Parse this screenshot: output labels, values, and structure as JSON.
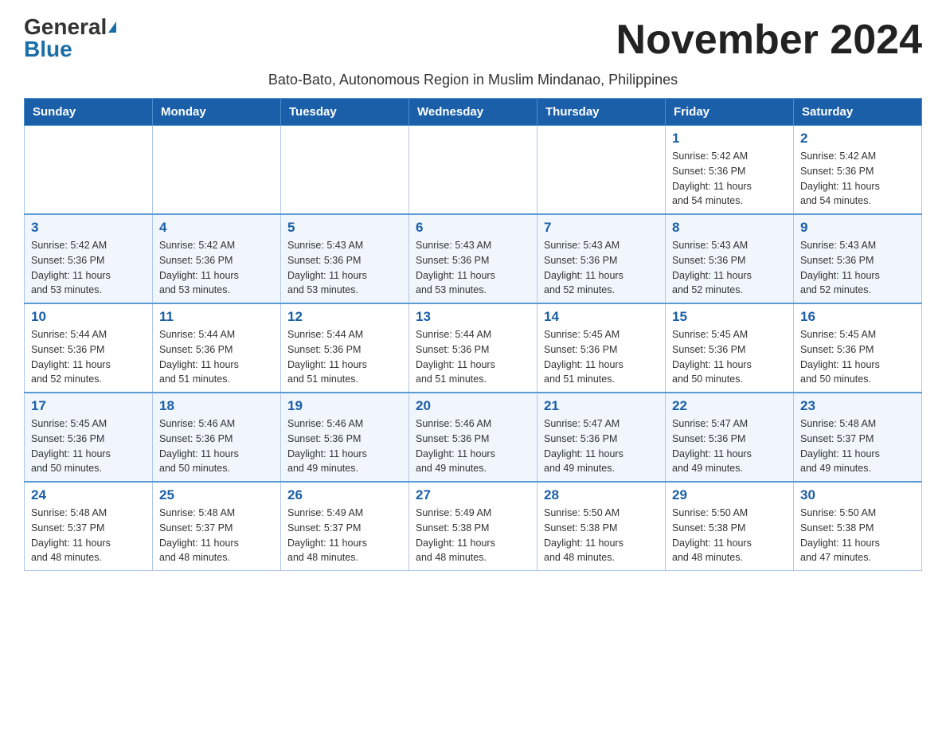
{
  "header": {
    "logo_general": "General",
    "logo_blue": "Blue",
    "month_title": "November 2024",
    "subtitle": "Bato-Bato, Autonomous Region in Muslim Mindanao, Philippines"
  },
  "days_of_week": [
    "Sunday",
    "Monday",
    "Tuesday",
    "Wednesday",
    "Thursday",
    "Friday",
    "Saturday"
  ],
  "weeks": [
    {
      "days": [
        {
          "number": "",
          "info": ""
        },
        {
          "number": "",
          "info": ""
        },
        {
          "number": "",
          "info": ""
        },
        {
          "number": "",
          "info": ""
        },
        {
          "number": "",
          "info": ""
        },
        {
          "number": "1",
          "info": "Sunrise: 5:42 AM\nSunset: 5:36 PM\nDaylight: 11 hours\nand 54 minutes."
        },
        {
          "number": "2",
          "info": "Sunrise: 5:42 AM\nSunset: 5:36 PM\nDaylight: 11 hours\nand 54 minutes."
        }
      ]
    },
    {
      "days": [
        {
          "number": "3",
          "info": "Sunrise: 5:42 AM\nSunset: 5:36 PM\nDaylight: 11 hours\nand 53 minutes."
        },
        {
          "number": "4",
          "info": "Sunrise: 5:42 AM\nSunset: 5:36 PM\nDaylight: 11 hours\nand 53 minutes."
        },
        {
          "number": "5",
          "info": "Sunrise: 5:43 AM\nSunset: 5:36 PM\nDaylight: 11 hours\nand 53 minutes."
        },
        {
          "number": "6",
          "info": "Sunrise: 5:43 AM\nSunset: 5:36 PM\nDaylight: 11 hours\nand 53 minutes."
        },
        {
          "number": "7",
          "info": "Sunrise: 5:43 AM\nSunset: 5:36 PM\nDaylight: 11 hours\nand 52 minutes."
        },
        {
          "number": "8",
          "info": "Sunrise: 5:43 AM\nSunset: 5:36 PM\nDaylight: 11 hours\nand 52 minutes."
        },
        {
          "number": "9",
          "info": "Sunrise: 5:43 AM\nSunset: 5:36 PM\nDaylight: 11 hours\nand 52 minutes."
        }
      ]
    },
    {
      "days": [
        {
          "number": "10",
          "info": "Sunrise: 5:44 AM\nSunset: 5:36 PM\nDaylight: 11 hours\nand 52 minutes."
        },
        {
          "number": "11",
          "info": "Sunrise: 5:44 AM\nSunset: 5:36 PM\nDaylight: 11 hours\nand 51 minutes."
        },
        {
          "number": "12",
          "info": "Sunrise: 5:44 AM\nSunset: 5:36 PM\nDaylight: 11 hours\nand 51 minutes."
        },
        {
          "number": "13",
          "info": "Sunrise: 5:44 AM\nSunset: 5:36 PM\nDaylight: 11 hours\nand 51 minutes."
        },
        {
          "number": "14",
          "info": "Sunrise: 5:45 AM\nSunset: 5:36 PM\nDaylight: 11 hours\nand 51 minutes."
        },
        {
          "number": "15",
          "info": "Sunrise: 5:45 AM\nSunset: 5:36 PM\nDaylight: 11 hours\nand 50 minutes."
        },
        {
          "number": "16",
          "info": "Sunrise: 5:45 AM\nSunset: 5:36 PM\nDaylight: 11 hours\nand 50 minutes."
        }
      ]
    },
    {
      "days": [
        {
          "number": "17",
          "info": "Sunrise: 5:45 AM\nSunset: 5:36 PM\nDaylight: 11 hours\nand 50 minutes."
        },
        {
          "number": "18",
          "info": "Sunrise: 5:46 AM\nSunset: 5:36 PM\nDaylight: 11 hours\nand 50 minutes."
        },
        {
          "number": "19",
          "info": "Sunrise: 5:46 AM\nSunset: 5:36 PM\nDaylight: 11 hours\nand 49 minutes."
        },
        {
          "number": "20",
          "info": "Sunrise: 5:46 AM\nSunset: 5:36 PM\nDaylight: 11 hours\nand 49 minutes."
        },
        {
          "number": "21",
          "info": "Sunrise: 5:47 AM\nSunset: 5:36 PM\nDaylight: 11 hours\nand 49 minutes."
        },
        {
          "number": "22",
          "info": "Sunrise: 5:47 AM\nSunset: 5:36 PM\nDaylight: 11 hours\nand 49 minutes."
        },
        {
          "number": "23",
          "info": "Sunrise: 5:48 AM\nSunset: 5:37 PM\nDaylight: 11 hours\nand 49 minutes."
        }
      ]
    },
    {
      "days": [
        {
          "number": "24",
          "info": "Sunrise: 5:48 AM\nSunset: 5:37 PM\nDaylight: 11 hours\nand 48 minutes."
        },
        {
          "number": "25",
          "info": "Sunrise: 5:48 AM\nSunset: 5:37 PM\nDaylight: 11 hours\nand 48 minutes."
        },
        {
          "number": "26",
          "info": "Sunrise: 5:49 AM\nSunset: 5:37 PM\nDaylight: 11 hours\nand 48 minutes."
        },
        {
          "number": "27",
          "info": "Sunrise: 5:49 AM\nSunset: 5:38 PM\nDaylight: 11 hours\nand 48 minutes."
        },
        {
          "number": "28",
          "info": "Sunrise: 5:50 AM\nSunset: 5:38 PM\nDaylight: 11 hours\nand 48 minutes."
        },
        {
          "number": "29",
          "info": "Sunrise: 5:50 AM\nSunset: 5:38 PM\nDaylight: 11 hours\nand 48 minutes."
        },
        {
          "number": "30",
          "info": "Sunrise: 5:50 AM\nSunset: 5:38 PM\nDaylight: 11 hours\nand 47 minutes."
        }
      ]
    }
  ]
}
